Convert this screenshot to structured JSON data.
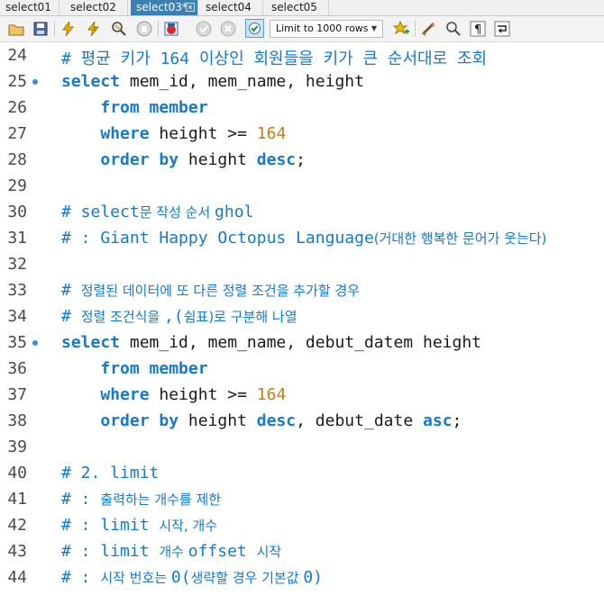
{
  "tabs": [
    {
      "label": "select01",
      "active": false
    },
    {
      "label": "select02",
      "active": false
    },
    {
      "label": "select03*",
      "active": true
    },
    {
      "label": "select04",
      "active": false
    },
    {
      "label": "select05",
      "active": false
    }
  ],
  "toolbar": {
    "limit_select_value": "Limit to 1000 rows",
    "icons": [
      "open-folder-icon",
      "save-icon",
      "execute-icon",
      "execute-current-icon",
      "explain-icon",
      "stop-icon",
      "toggle-error-icon",
      "commit-icon",
      "rollback-icon",
      "autocommit-icon",
      "bookmark-icon",
      "beautify-icon",
      "find-icon",
      "invisible-chars-icon",
      "wrap-icon"
    ]
  },
  "editor": {
    "lines": [
      {
        "number": "24",
        "marker": false,
        "tokens": [
          {
            "t": "# 평균 키가 ",
            "c": "cm"
          },
          {
            "t": "164",
            "c": "cm"
          },
          {
            "t": " 이상인 회원들을 키가 큰 순서대로 조회",
            "c": "cm"
          }
        ]
      },
      {
        "number": "25",
        "marker": true,
        "tokens": [
          {
            "t": "select",
            "c": "kw"
          },
          {
            "t": " mem_id, mem_name, height",
            "c": "id"
          }
        ]
      },
      {
        "number": "26",
        "marker": false,
        "tokens": [
          {
            "t": "    ",
            "c": "id"
          },
          {
            "t": "from member",
            "c": "kw"
          }
        ]
      },
      {
        "number": "27",
        "marker": false,
        "tokens": [
          {
            "t": "    ",
            "c": "id"
          },
          {
            "t": "where",
            "c": "kw"
          },
          {
            "t": " height >= ",
            "c": "id"
          },
          {
            "t": "164",
            "c": "num"
          }
        ]
      },
      {
        "number": "28",
        "marker": false,
        "tokens": [
          {
            "t": "    ",
            "c": "id"
          },
          {
            "t": "order by",
            "c": "kw"
          },
          {
            "t": " height ",
            "c": "id"
          },
          {
            "t": "desc",
            "c": "kw"
          },
          {
            "t": ";",
            "c": "id"
          }
        ]
      },
      {
        "number": "29",
        "marker": false,
        "tokens": []
      },
      {
        "number": "30",
        "marker": false,
        "tokens": [
          {
            "t": "# select",
            "c": "cm"
          },
          {
            "t": "문 작성 순서 ",
            "c": "cm ko"
          },
          {
            "t": "ghol",
            "c": "cm"
          }
        ]
      },
      {
        "number": "31",
        "marker": false,
        "tokens": [
          {
            "t": "# : Giant Happy Octopus Language",
            "c": "cm"
          },
          {
            "t": "(거대한 행복한 문어가 웃는다)",
            "c": "cm ko"
          }
        ]
      },
      {
        "number": "32",
        "marker": false,
        "tokens": []
      },
      {
        "number": "33",
        "marker": false,
        "tokens": [
          {
            "t": "# ",
            "c": "cm"
          },
          {
            "t": "정렬된 데이터에 또 다른 정렬 조건을 추가할 경우",
            "c": "cm ko"
          }
        ]
      },
      {
        "number": "34",
        "marker": false,
        "tokens": [
          {
            "t": "# ",
            "c": "cm"
          },
          {
            "t": "정렬 조건식을 ",
            "c": "cm ko"
          },
          {
            "t": ",(",
            "c": "cm"
          },
          {
            "t": "쉼표)로 구분해 나열",
            "c": "cm ko"
          }
        ]
      },
      {
        "number": "35",
        "marker": true,
        "tokens": [
          {
            "t": "select",
            "c": "kw"
          },
          {
            "t": " mem_id, mem_name, debut_datem height",
            "c": "id"
          }
        ]
      },
      {
        "number": "36",
        "marker": false,
        "tokens": [
          {
            "t": "    ",
            "c": "id"
          },
          {
            "t": "from member",
            "c": "kw"
          }
        ]
      },
      {
        "number": "37",
        "marker": false,
        "tokens": [
          {
            "t": "    ",
            "c": "id"
          },
          {
            "t": "where",
            "c": "kw"
          },
          {
            "t": " height >= ",
            "c": "id"
          },
          {
            "t": "164",
            "c": "num"
          }
        ]
      },
      {
        "number": "38",
        "marker": false,
        "tokens": [
          {
            "t": "    ",
            "c": "id"
          },
          {
            "t": "order by",
            "c": "kw"
          },
          {
            "t": " height ",
            "c": "id"
          },
          {
            "t": "desc",
            "c": "kw"
          },
          {
            "t": ", debut_date ",
            "c": "id"
          },
          {
            "t": "asc",
            "c": "kw"
          },
          {
            "t": ";",
            "c": "id"
          }
        ]
      },
      {
        "number": "39",
        "marker": false,
        "tokens": []
      },
      {
        "number": "40",
        "marker": false,
        "tokens": [
          {
            "t": "# 2. limit",
            "c": "cm"
          }
        ]
      },
      {
        "number": "41",
        "marker": false,
        "tokens": [
          {
            "t": "# : ",
            "c": "cm"
          },
          {
            "t": "출력하는 개수를 제한",
            "c": "cm ko"
          }
        ]
      },
      {
        "number": "42",
        "marker": false,
        "tokens": [
          {
            "t": "# : limit ",
            "c": "cm"
          },
          {
            "t": "시작, 개수",
            "c": "cm ko"
          }
        ]
      },
      {
        "number": "43",
        "marker": false,
        "tokens": [
          {
            "t": "# : limit ",
            "c": "cm"
          },
          {
            "t": "개수 ",
            "c": "cm ko"
          },
          {
            "t": "offset ",
            "c": "cm"
          },
          {
            "t": "시작",
            "c": "cm ko"
          }
        ]
      },
      {
        "number": "44",
        "marker": false,
        "tokens": [
          {
            "t": "# : ",
            "c": "cm"
          },
          {
            "t": "시작 번호는 ",
            "c": "cm ko"
          },
          {
            "t": "0(",
            "c": "cm"
          },
          {
            "t": "생략할 경우 기본값 ",
            "c": "cm ko"
          },
          {
            "t": "0)",
            "c": "cm"
          }
        ]
      }
    ]
  },
  "colors": {
    "keyword": "#1679c9",
    "number": "#c87a14",
    "comment": "#1679c9",
    "active_tab": "#3c7fb1"
  }
}
